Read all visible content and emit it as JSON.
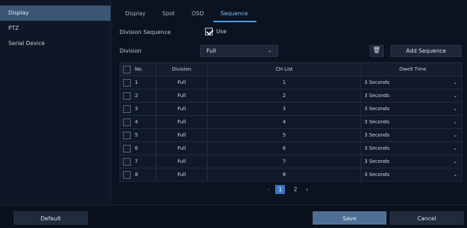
{
  "sidebar": {
    "items": [
      {
        "label": "Display"
      },
      {
        "label": "PTZ"
      },
      {
        "label": "Serial Device"
      }
    ]
  },
  "tabs": [
    {
      "label": "Display"
    },
    {
      "label": "Spot"
    },
    {
      "label": "OSD"
    },
    {
      "label": "Sequence"
    }
  ],
  "division_sequence": {
    "label": "Division Sequence",
    "use_label": "Use",
    "checked": true
  },
  "division": {
    "label": "Division",
    "value": "Full"
  },
  "toolbar": {
    "add_sequence_label": "Add Sequence"
  },
  "table": {
    "headers": {
      "no": "No.",
      "division": "Division",
      "ch_list": "CH List",
      "dwell": "Dwell Time"
    },
    "rows": [
      {
        "no": "1",
        "division": "Full",
        "ch": "1",
        "dwell": "3 Seconds"
      },
      {
        "no": "2",
        "division": "Full",
        "ch": "2",
        "dwell": "3 Seconds"
      },
      {
        "no": "3",
        "division": "Full",
        "ch": "3",
        "dwell": "3 Seconds"
      },
      {
        "no": "4",
        "division": "Full",
        "ch": "4",
        "dwell": "3 Seconds"
      },
      {
        "no": "5",
        "division": "Full",
        "ch": "5",
        "dwell": "3 Seconds"
      },
      {
        "no": "6",
        "division": "Full",
        "ch": "6",
        "dwell": "3 Seconds"
      },
      {
        "no": "7",
        "division": "Full",
        "ch": "7",
        "dwell": "3 Seconds"
      },
      {
        "no": "8",
        "division": "Full",
        "ch": "8",
        "dwell": "3 Seconds"
      }
    ]
  },
  "pager": {
    "pages": [
      "1",
      "2"
    ],
    "current": "1"
  },
  "footer": {
    "default_label": "Default",
    "save_label": "Save",
    "cancel_label": "Cancel"
  },
  "icons": {
    "trash": "trash-icon",
    "chevron": "chevron-down-icon"
  }
}
